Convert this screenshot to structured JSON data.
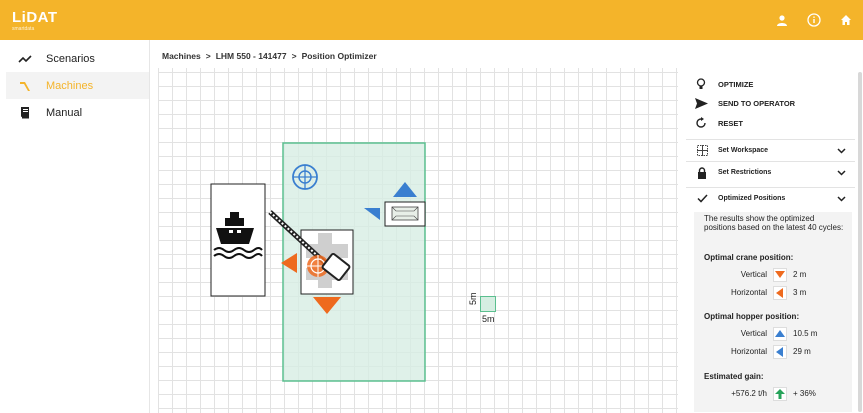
{
  "brand": {
    "name": "LiDAT",
    "sub": "smartdata"
  },
  "nav": [
    {
      "label": "Scenarios",
      "icon": "trend-line-icon",
      "active": false
    },
    {
      "label": "Machines",
      "icon": "crane-icon",
      "active": true
    },
    {
      "label": "Manual",
      "icon": "book-icon",
      "active": false
    }
  ],
  "breadcrumb": {
    "items": [
      "Machines",
      "LHM 550 - 141477",
      "Position Optimizer"
    ],
    "separator": ">"
  },
  "canvas": {
    "scale_label_v": "5m",
    "scale_label_h": "5m"
  },
  "panel": {
    "actions": [
      {
        "label": "OPTIMIZE",
        "icon": "lightbulb-icon"
      },
      {
        "label": "SEND TO OPERATOR",
        "icon": "send-icon"
      },
      {
        "label": "RESET",
        "icon": "reset-icon"
      }
    ],
    "accordions": [
      {
        "label": "Set Workspace",
        "icon": "grid-icon"
      },
      {
        "label": "Set Restrictions",
        "icon": "lock-icon"
      },
      {
        "label": "Optimized Positions",
        "icon": "check-icon"
      }
    ],
    "description": "The results show the optimized positions based on the latest 40 cycles:",
    "crane": {
      "title": "Optimal crane position:",
      "rows": [
        {
          "label": "Vertical",
          "value": "2 m",
          "dir": "down",
          "color": "#ee6a1e"
        },
        {
          "label": "Horizontal",
          "value": "3 m",
          "dir": "left",
          "color": "#ee6a1e"
        }
      ]
    },
    "hopper": {
      "title": "Optimal hopper position:",
      "rows": [
        {
          "label": "Vertical",
          "value": "10.5 m",
          "dir": "up",
          "color": "#3a7fd0"
        },
        {
          "label": "Horizontal",
          "value": "29 m",
          "dir": "left",
          "color": "#3a7fd0"
        }
      ]
    },
    "gain": {
      "title": "Estimated gain:",
      "rate": "+576.2 t/h",
      "pct": "+ 36%",
      "color": "#27a35a"
    }
  },
  "colors": {
    "accent": "#f4b42a",
    "orange": "#ee6a1e",
    "blue": "#3a7fd0",
    "green": "#27a35a",
    "zone": "#5bbf8f"
  }
}
